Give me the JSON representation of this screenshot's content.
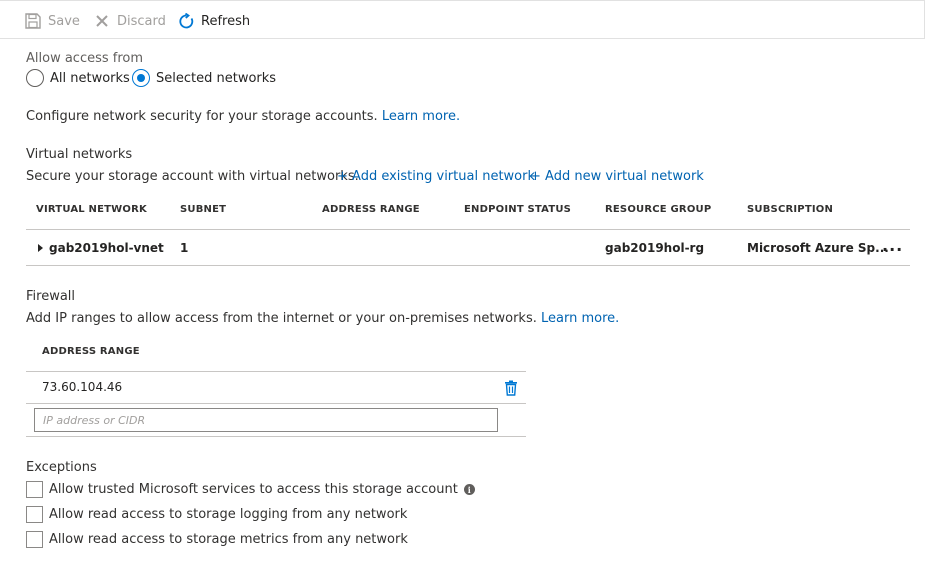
{
  "toolbar": {
    "save_label": "Save",
    "discard_label": "Discard",
    "refresh_label": "Refresh"
  },
  "access": {
    "heading": "Allow access from",
    "options": [
      "All networks",
      "Selected networks"
    ],
    "selected": "Selected networks"
  },
  "configure": {
    "text": "Configure network security for your storage accounts.",
    "learn_more": "Learn more."
  },
  "vnets": {
    "heading": "Virtual networks",
    "description": "Secure your storage account with virtual networks.",
    "add_existing": "+ Add existing virtual network",
    "add_new": "+ Add new virtual network",
    "columns": [
      "VIRTUAL NETWORK",
      "SUBNET",
      "ADDRESS RANGE",
      "ENDPOINT STATUS",
      "RESOURCE GROUP",
      "SUBSCRIPTION"
    ],
    "rows": [
      {
        "network": "gab2019hol-vnet",
        "subnet": "1",
        "address_range": "",
        "endpoint_status": "",
        "resource_group": "gab2019hol-rg",
        "subscription": "Microsoft Azure Sp...",
        "more": "..."
      }
    ]
  },
  "firewall": {
    "heading": "Firewall",
    "description": "Add IP ranges to allow access from the internet or your on-premises networks.",
    "learn_more": "Learn more.",
    "column": "ADDRESS RANGE",
    "ranges": [
      "73.60.104.46"
    ],
    "input_placeholder": "IP address or CIDR"
  },
  "exceptions": {
    "heading": "Exceptions",
    "items": [
      {
        "label": "Allow trusted Microsoft services to access this storage account",
        "checked": false,
        "info": true
      },
      {
        "label": "Allow read access to storage logging from any network",
        "checked": false,
        "info": false
      },
      {
        "label": "Allow read access to storage metrics from any network",
        "checked": false,
        "info": false
      }
    ]
  },
  "colors": {
    "accent": "#0078d4",
    "link": "#0063b1",
    "disabled": "#a19f9d"
  }
}
